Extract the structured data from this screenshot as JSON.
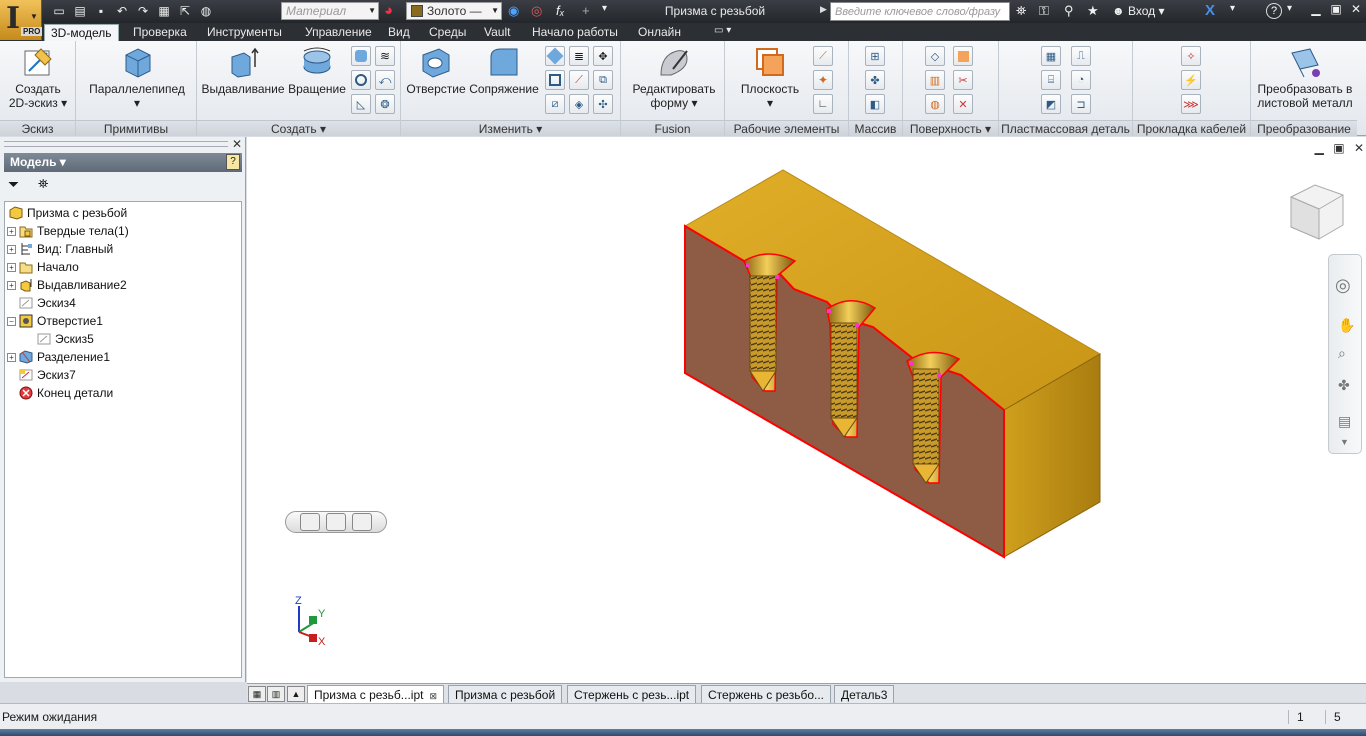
{
  "title_bar": {
    "material_placeholder": "Материал",
    "color_value": "Золото —",
    "document_title": "Призма с резьбой",
    "search_placeholder": "Введите ключевое слово/фразу",
    "signin_label": "Вход",
    "help_label": "?",
    "app_badge": "PRO"
  },
  "ribbon_tabs": [
    "3D-модель",
    "Проверка",
    "Инструменты",
    "Управление",
    "Вид",
    "Среды",
    "Vault",
    "Начало работы",
    "Онлайн"
  ],
  "ribbon": {
    "sketch": {
      "label": "Эскиз",
      "create_line1": "Создать",
      "create_line2": "2D-эскиз"
    },
    "primitives": {
      "label": "Примитивы",
      "box": "Параллелепипед"
    },
    "create": {
      "label": "Создать",
      "extrude": "Выдавливание",
      "revolve": "Вращение"
    },
    "modify": {
      "label": "Изменить",
      "hole": "Отверстие",
      "fillet": "Сопряжение"
    },
    "fusion": {
      "label": "Fusion",
      "edit_line1": "Редактировать",
      "edit_line2": "форму"
    },
    "work": {
      "label": "Рабочие элементы",
      "plane": "Плоскость"
    },
    "pattern": {
      "label": "Массив"
    },
    "surface": {
      "label": "Поверхность"
    },
    "plastic": {
      "label": "Пластмассовая деталь"
    },
    "cable": {
      "label": "Прокладка кабелей"
    },
    "convert": {
      "label": "Преобразование",
      "line1": "Преобразовать в",
      "line2": "листовой металл"
    }
  },
  "browser": {
    "header": "Модель",
    "tree": [
      {
        "label": "Призма с резьбой",
        "icon": "part-icon"
      },
      {
        "label": "Твердые тела(1)",
        "icon": "solid-bodies-icon"
      },
      {
        "label": "Вид: Главный",
        "icon": "view-rep-icon"
      },
      {
        "label": "Начало",
        "icon": "folder-icon"
      },
      {
        "label": "Выдавливание2",
        "icon": "extrude-icon"
      },
      {
        "label": "Эскиз4",
        "icon": "sketch-icon"
      },
      {
        "label": "Отверстие1",
        "icon": "hole-icon"
      },
      {
        "label": "Эскиз5",
        "icon": "sketch-icon"
      },
      {
        "label": "Разделение1",
        "icon": "split-icon"
      },
      {
        "label": "Эскиз7",
        "icon": "sketch-icon"
      },
      {
        "label": "Конец детали",
        "icon": "end-of-part-icon"
      }
    ]
  },
  "viewport": {
    "part_color": "#d6a521",
    "section_color": "#8e5b44",
    "edge_highlight": "#ff0000",
    "triad": {
      "z": "Z",
      "y": "Y",
      "x": "X"
    }
  },
  "doc_tabs": [
    "Призма с резьб...ipt",
    "Призма с резьбой",
    "Стержень с резь...ipt",
    "Стержень с резьбо...",
    "Деталь3"
  ],
  "status": {
    "text": "Режим ожидания",
    "count_a": "1",
    "count_b": "5"
  }
}
